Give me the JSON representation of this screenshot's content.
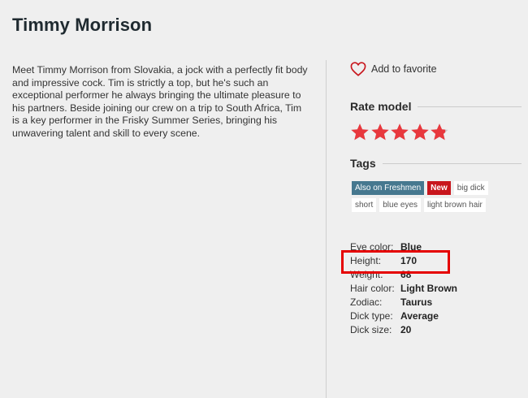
{
  "page": {
    "title": "Timmy Morrison"
  },
  "description": "Meet Timmy Morrison from Slovakia, a jock with a perfectly fit body and impressive cock. Tim is strictly a top, but he's such an exceptional performer he always bringing the ultimate pleasure to his partners. Beside joining our crew on a trip to South Africa, Tim is a key performer in the Frisky Summer Series, bringing his unwavering talent and skill to every scene.",
  "favorite": {
    "icon": "heart-outline-icon",
    "label": "Add to favorite"
  },
  "rating": {
    "heading": "Rate model",
    "value": 4.8,
    "max": 5,
    "star_color": "#e8383d",
    "empty_color": "#cccccc"
  },
  "tags": {
    "heading": "Tags",
    "items": [
      {
        "label": "Also on Freshmen",
        "style": "blue"
      },
      {
        "label": "New",
        "style": "red"
      },
      {
        "label": "big dick",
        "style": "plain"
      },
      {
        "label": "short",
        "style": "plain"
      },
      {
        "label": "blue eyes",
        "style": "plain"
      },
      {
        "label": "light brown hair",
        "style": "plain"
      }
    ]
  },
  "details": [
    {
      "key": "Eye color:",
      "value": "Blue"
    },
    {
      "key": "Height:",
      "value": "170"
    },
    {
      "key": "Weight:",
      "value": "68"
    },
    {
      "key": "Hair color:",
      "value": "Light Brown"
    },
    {
      "key": "Zodiac:",
      "value": "Taurus"
    },
    {
      "key": "Dick type:",
      "value": "Average"
    },
    {
      "key": "Dick size:",
      "value": "20"
    }
  ],
  "annotation": {
    "color": "#e50000",
    "target": "Height"
  }
}
